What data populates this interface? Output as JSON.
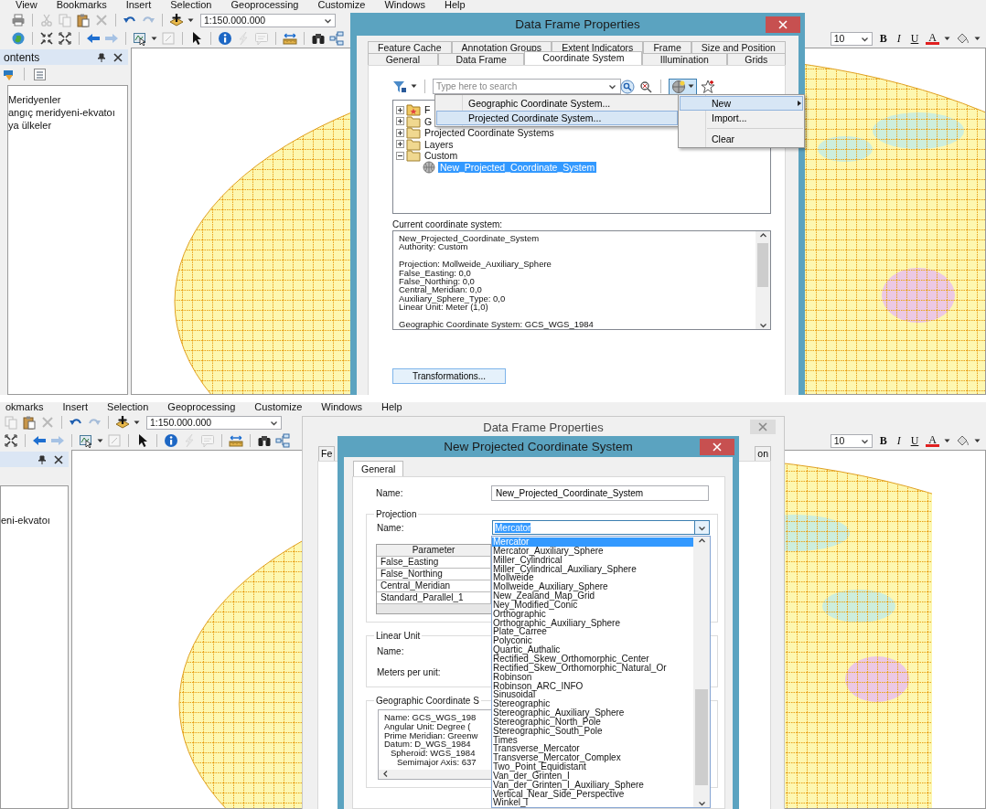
{
  "top_screenshot": {
    "app": {
      "menu_bar": [
        "View",
        "Bookmarks",
        "Insert",
        "Selection",
        "Geoprocessing",
        "Customize",
        "Windows",
        "Help"
      ],
      "standard_toolbar": [
        {
          "kind": "print",
          "disabled": false
        },
        {
          "kind": "separator"
        },
        {
          "kind": "cut",
          "disabled": true
        },
        {
          "kind": "copy",
          "disabled": true
        },
        {
          "kind": "paste",
          "disabled": false
        },
        {
          "kind": "delete",
          "disabled": true
        },
        {
          "kind": "separator"
        },
        {
          "kind": "undo",
          "disabled": false
        },
        {
          "kind": "redo",
          "disabled": true
        },
        {
          "kind": "separator"
        },
        {
          "kind": "add-data",
          "disabled": false
        },
        {
          "kind": "caret",
          "disabled": false
        }
      ],
      "scale": "1:150.000.000",
      "tools_toolbar": [
        {
          "kind": "globe",
          "disabled": false
        },
        {
          "kind": "separator"
        },
        {
          "kind": "zoom-in-arrows",
          "disabled": false
        },
        {
          "kind": "zoom-out-arrows",
          "disabled": false
        },
        {
          "kind": "separator"
        },
        {
          "kind": "back",
          "disabled": false
        },
        {
          "kind": "forward",
          "disabled": true
        },
        {
          "kind": "separator"
        },
        {
          "kind": "select-features",
          "disabled": false
        },
        {
          "kind": "caret",
          "disabled": false
        },
        {
          "kind": "clear-selection",
          "disabled": true
        },
        {
          "kind": "separator"
        },
        {
          "kind": "pointer",
          "disabled": false
        },
        {
          "kind": "separator"
        },
        {
          "kind": "identify",
          "disabled": false
        },
        {
          "kind": "hyperlink",
          "disabled": true
        },
        {
          "kind": "popup",
          "disabled": true
        },
        {
          "kind": "separator"
        },
        {
          "kind": "measure",
          "disabled": false
        },
        {
          "kind": "separator"
        },
        {
          "kind": "find",
          "disabled": false
        },
        {
          "kind": "route",
          "disabled": false
        }
      ],
      "format_toolbar": {
        "font_size": "10",
        "buttons": [
          {
            "kind": "bold",
            "label": "B"
          },
          {
            "kind": "italic",
            "label": "I"
          },
          {
            "kind": "underline",
            "label": "U"
          },
          {
            "kind": "font-color",
            "label": "A"
          }
        ]
      },
      "table_of_contents": {
        "title": "ontents",
        "toc_tools": [
          {
            "kind": "drawing-order"
          },
          {
            "kind": "source"
          }
        ],
        "layers": [
          "Meridyenler",
          "angıç meridyeni-ekvatoı",
          "ya ülkeler"
        ]
      }
    },
    "data_frame_dialog": {
      "title": "Data Frame Properties",
      "tab_rows": [
        [
          {
            "label": "Feature Cache",
            "selected": false
          },
          {
            "label": "Annotation Groups",
            "selected": false
          },
          {
            "label": "Extent Indicators",
            "selected": false
          },
          {
            "label": "Frame",
            "selected": false
          },
          {
            "label": "Size and Position",
            "selected": false
          }
        ],
        [
          {
            "label": "General",
            "selected": false
          },
          {
            "label": "Data Frame",
            "selected": false
          },
          {
            "label": "Coordinate System",
            "selected": true
          },
          {
            "label": "Illumination",
            "selected": false
          },
          {
            "label": "Grids",
            "selected": false
          }
        ]
      ],
      "search": {
        "placeholder": "Type here to search"
      },
      "tree": [
        {
          "kind": "favorites-folder",
          "label": "F",
          "expanded": false,
          "selected": false
        },
        {
          "kind": "folder",
          "label": "G",
          "expanded": false,
          "selected": false
        },
        {
          "kind": "folder",
          "label": "Projected Coordinate Systems",
          "expanded": false,
          "selected": false
        },
        {
          "kind": "folder",
          "label": "Layers",
          "expanded": false,
          "selected": false
        },
        {
          "kind": "folder",
          "label": "Custom",
          "expanded": true,
          "selected": false,
          "children": [
            {
              "kind": "coordinate-system",
              "label": "New_Projected_Coordinate_System",
              "selected": true
            }
          ]
        }
      ],
      "add_menu": [
        {
          "label": "New",
          "selected": true,
          "has_submenu": true
        },
        {
          "label": "Import...",
          "selected": false
        },
        {
          "label": "Clear",
          "selected": false,
          "separator_before": true
        }
      ],
      "new_submenu": [
        {
          "label": "Geographic Coordinate System...",
          "selected": false
        },
        {
          "label": "Projected Coordinate System...",
          "selected": true
        }
      ],
      "current_label": "Current coordinate system:",
      "current_details": [
        [
          "New_Projected_Coordinate_System",
          "Authority: Custom"
        ],
        [
          "Projection: Mollweide_Auxiliary_Sphere",
          "False_Easting: 0,0",
          "False_Northing: 0,0",
          "Central_Meridian: 0,0",
          "Auxiliary_Sphere_Type: 0,0",
          "Linear Unit: Meter (1,0)"
        ],
        [
          "Geographic Coordinate System: GCS_WGS_1984"
        ]
      ],
      "transformations_button": "Transformations..."
    }
  },
  "bottom_screenshot": {
    "app": {
      "menu_bar": [
        "okmarks",
        "Insert",
        "Selection",
        "Geoprocessing",
        "Customize",
        "Windows",
        "Help"
      ],
      "standard_toolbar": [
        {
          "kind": "copy",
          "disabled": true
        },
        {
          "kind": "paste",
          "disabled": false
        },
        {
          "kind": "delete",
          "disabled": true
        },
        {
          "kind": "separator"
        },
        {
          "kind": "undo",
          "disabled": false
        },
        {
          "kind": "redo",
          "disabled": true
        },
        {
          "kind": "separator"
        },
        {
          "kind": "add-data",
          "disabled": false
        },
        {
          "kind": "caret",
          "disabled": false
        }
      ],
      "scale": "1:150.000.000",
      "tools_toolbar": [
        {
          "kind": "zoom-out-arrows",
          "disabled": false
        },
        {
          "kind": "separator"
        },
        {
          "kind": "back",
          "disabled": false
        },
        {
          "kind": "forward",
          "disabled": true
        },
        {
          "kind": "separator"
        },
        {
          "kind": "select-features",
          "disabled": false
        },
        {
          "kind": "caret",
          "disabled": false
        },
        {
          "kind": "clear-selection",
          "disabled": true
        },
        {
          "kind": "separator"
        },
        {
          "kind": "pointer",
          "disabled": false
        },
        {
          "kind": "separator"
        },
        {
          "kind": "identify",
          "disabled": false
        },
        {
          "kind": "hyperlink",
          "disabled": true
        },
        {
          "kind": "popup",
          "disabled": true
        },
        {
          "kind": "separator"
        },
        {
          "kind": "measure",
          "disabled": false
        },
        {
          "kind": "separator"
        },
        {
          "kind": "find",
          "disabled": false
        },
        {
          "kind": "route",
          "disabled": false
        }
      ],
      "format_toolbar": {
        "font_size": "10",
        "buttons": [
          {
            "kind": "bold",
            "label": "B"
          },
          {
            "kind": "italic",
            "label": "I"
          },
          {
            "kind": "underline",
            "label": "U"
          },
          {
            "kind": "font-color",
            "label": "A"
          }
        ]
      },
      "table_of_contents": {
        "layers": [
          "eni-ekvatoı"
        ]
      }
    },
    "background_dialog": {
      "title": "Data Frame Properties",
      "tabs": [
        "Fe",
        "on"
      ]
    },
    "new_pcs_dialog": {
      "title": "New Projected Coordinate System",
      "tabs": [
        {
          "label": "General",
          "selected": true
        }
      ],
      "name_label": "Name:",
      "name_value": "New_Projected_Coordinate_System",
      "projection": {
        "title": "Projection",
        "name_label": "Name:",
        "value": "Mercator",
        "parameter_header": "Parameter",
        "parameters": [
          "False_Easting",
          "False_Northing",
          "Central_Meridian",
          "Standard_Parallel_1"
        ],
        "options": [
          {
            "label": "Mercator",
            "selected": true
          },
          {
            "label": "Mercator_Auxiliary_Sphere",
            "selected": false
          },
          {
            "label": "Miller_Cylindrical",
            "selected": false
          },
          {
            "label": "Miller_Cylindrical_Auxiliary_Sphere",
            "selected": false
          },
          {
            "label": "Mollweide",
            "selected": false
          },
          {
            "label": "Mollweide_Auxiliary_Sphere",
            "selected": false
          },
          {
            "label": "New_Zealand_Map_Grid",
            "selected": false
          },
          {
            "label": "Ney_Modified_Conic",
            "selected": false
          },
          {
            "label": "Orthographic",
            "selected": false
          },
          {
            "label": "Orthographic_Auxiliary_Sphere",
            "selected": false
          },
          {
            "label": "Plate_Carree",
            "selected": false
          },
          {
            "label": "Polyconic",
            "selected": false
          },
          {
            "label": "Quartic_Authalic",
            "selected": false
          },
          {
            "label": "Rectified_Skew_Orthomorphic_Center",
            "selected": false
          },
          {
            "label": "Rectified_Skew_Orthomorphic_Natural_Or",
            "selected": false
          },
          {
            "label": "Robinson",
            "selected": false
          },
          {
            "label": "Robinson_ARC_INFO",
            "selected": false
          },
          {
            "label": "Sinusoidal",
            "selected": false
          },
          {
            "label": "Stereographic",
            "selected": false
          },
          {
            "label": "Stereographic_Auxiliary_Sphere",
            "selected": false
          },
          {
            "label": "Stereographic_North_Pole",
            "selected": false
          },
          {
            "label": "Stereographic_South_Pole",
            "selected": false
          },
          {
            "label": "Times",
            "selected": false
          },
          {
            "label": "Transverse_Mercator",
            "selected": false
          },
          {
            "label": "Transverse_Mercator_Complex",
            "selected": false
          },
          {
            "label": "Two_Point_Equidistant",
            "selected": false
          },
          {
            "label": "Van_der_Grinten_I",
            "selected": false
          },
          {
            "label": "Van_der_Grinten_I_Auxiliary_Sphere",
            "selected": false
          },
          {
            "label": "Vertical_Near_Side_Perspective",
            "selected": false
          },
          {
            "label": "Winkel_I",
            "selected": false
          }
        ]
      },
      "linear_unit": {
        "title": "Linear Unit",
        "name_label": "Name:",
        "meters_label": "Meters per unit:"
      },
      "geographic": {
        "title": "Geographic Coordinate S",
        "details": [
          {
            "text": "Name: GCS_WGS_198"
          },
          {
            "text": "Angular Unit: Degree ("
          },
          {
            "text": "Prime Meridian: Greenw"
          },
          {
            "text": "Datum: D_WGS_1984",
            "children": [
              {
                "text": "Spheroid: WGS_1984",
                "children": [
                  {
                    "text": "Semimajor Axis: 637"
                  }
                ]
              }
            ]
          }
        ]
      }
    }
  }
}
